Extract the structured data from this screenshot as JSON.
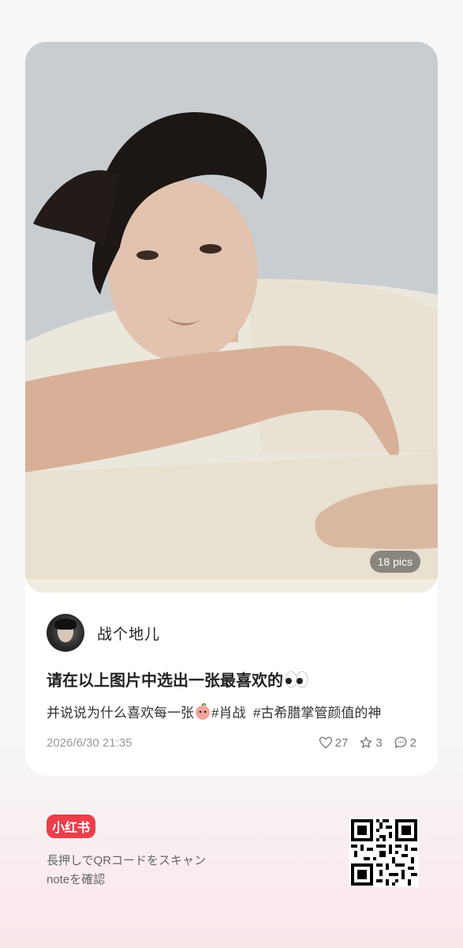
{
  "post": {
    "image_count_badge": "18 pics",
    "author": {
      "name": "战个地儿"
    },
    "title": "请在以上图片中选出一张最喜欢的",
    "desc_text": "并说说为什么喜欢每一张",
    "tags": [
      "#肖战",
      "#古希腊掌管颜值的神"
    ],
    "date": "2026/6/30 21:35",
    "likes": "27",
    "collects": "3",
    "comments": "2"
  },
  "footer": {
    "logo_text": "小红书",
    "scan_line1": "長押しでQRコードをスキャン",
    "scan_line2": "noteを確認"
  },
  "colors": {
    "brand_red": "#ea3f4b",
    "card_bg": "#ffffff",
    "muted_text": "#999999"
  },
  "icons": {
    "like": "heart-icon",
    "collect": "star-icon",
    "comment": "comment-icon"
  }
}
